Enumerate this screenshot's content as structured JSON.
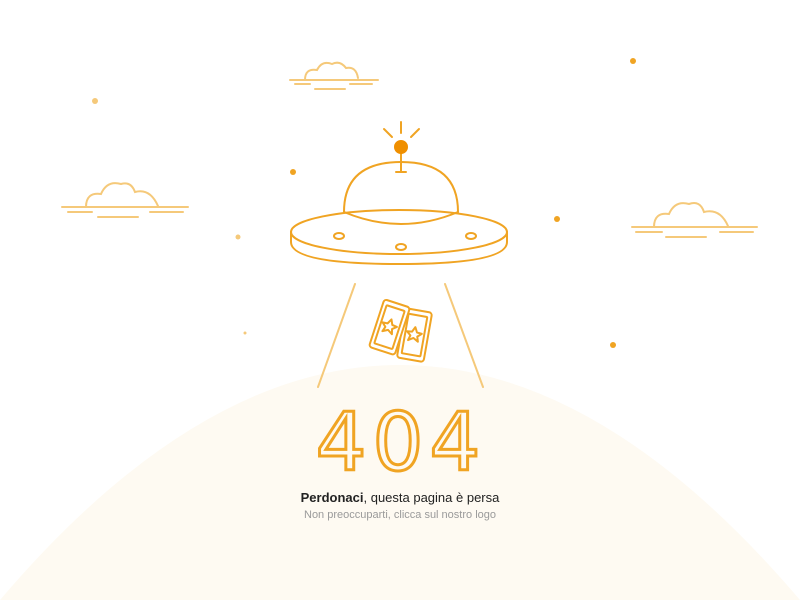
{
  "error": {
    "code": "404",
    "title_bold": "Perdonaci",
    "title_rest": ", questa pagina è persa",
    "subtitle": "Non preoccuparti, clicca sul nostro logo"
  },
  "colors": {
    "accent": "#f0a423",
    "accent_dark": "#ef8f00",
    "accent_light": "#f5c97a",
    "hill": "#fefaf2",
    "text": "#222222",
    "muted": "#9a9a9a"
  },
  "icons": {
    "ufo": "ufo-icon",
    "tickets": "ticket-icon",
    "beacon": "beacon-light-icon",
    "cloud": "cloud-icon"
  }
}
